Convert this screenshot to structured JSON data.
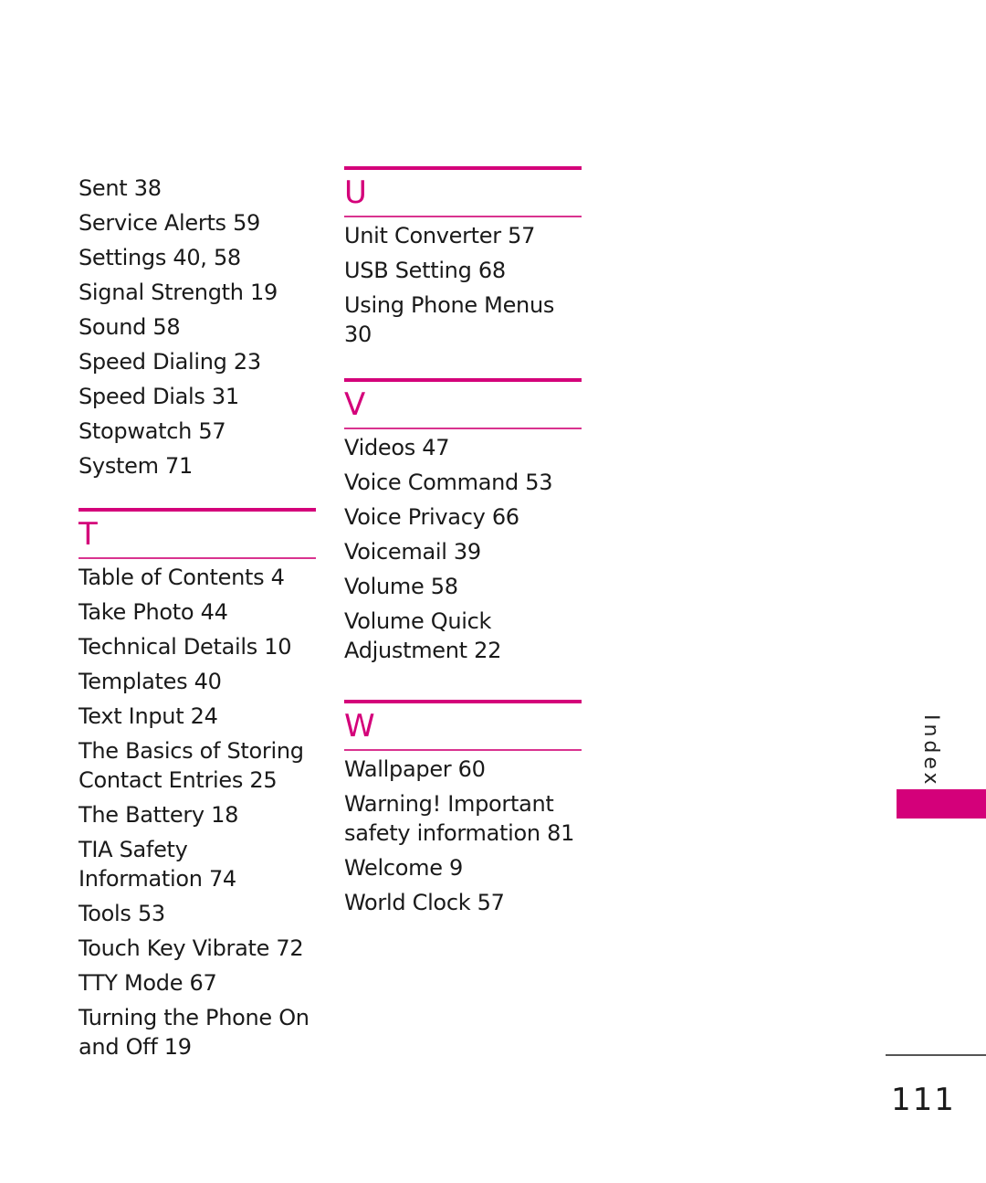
{
  "column1": {
    "s_entries": [
      "Sent 38",
      "Service Alerts 59",
      "Settings 40, 58",
      "Signal Strength 19",
      "Sound 58",
      "Speed Dialing 23",
      "Speed Dials 31",
      "Stopwatch 57",
      "System 71"
    ],
    "t_section": {
      "letter": "T",
      "entries": [
        "Table of Contents 4",
        "Take Photo 44",
        "Technical Details 10",
        "Templates 40",
        "Text Input 24",
        "The Basics of Storing Contact Entries 25",
        "The Battery 18",
        "TIA Safety Information 74",
        "Tools 53",
        "Touch Key Vibrate 72",
        "TTY Mode 67",
        "Turning the Phone On and Off 19"
      ]
    }
  },
  "column2": {
    "u_section": {
      "letter": "U",
      "entries": [
        "Unit Converter 57",
        "USB Setting 68",
        "Using Phone Menus 30"
      ]
    },
    "v_section": {
      "letter": "V",
      "entries": [
        "Videos 47",
        "Voice Command 53",
        "Voice Privacy 66",
        "Voicemail 39",
        "Volume 58",
        "Volume Quick Adjustment 22"
      ]
    },
    "w_section": {
      "letter": "W",
      "entries": [
        "Wallpaper 60",
        "Warning! Important safety information 81",
        "Welcome 9",
        "World Clock 57"
      ]
    }
  },
  "side_tab": {
    "label": "Index"
  },
  "footer": {
    "page_number": "111"
  },
  "colors": {
    "accent": "#d4007a",
    "text": "#1a1a1a"
  }
}
